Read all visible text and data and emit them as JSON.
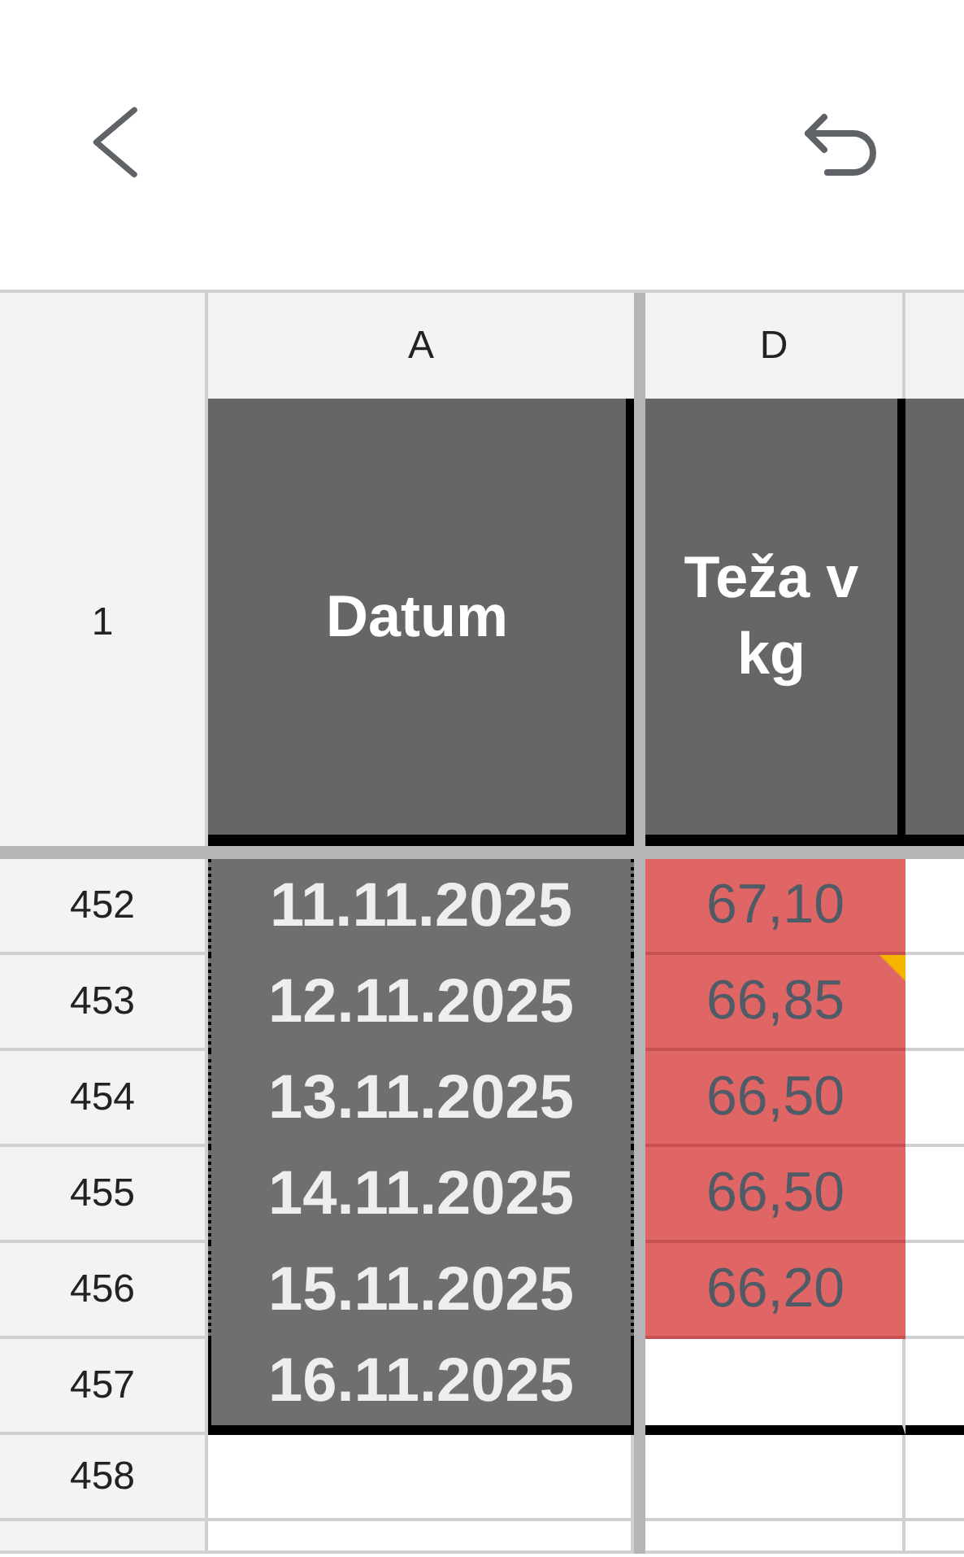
{
  "columns": [
    "A",
    "D"
  ],
  "header_row": {
    "number": "1",
    "cells": [
      "Datum",
      "Teža v kg"
    ]
  },
  "rows": [
    {
      "number": "452",
      "date": "11.11.2025",
      "weight": "67,10",
      "note": false
    },
    {
      "number": "453",
      "date": "12.11.2025",
      "weight": "66,85",
      "note": true
    },
    {
      "number": "454",
      "date": "13.11.2025",
      "weight": "66,50",
      "note": false
    },
    {
      "number": "455",
      "date": "14.11.2025",
      "weight": "66,50",
      "note": false
    },
    {
      "number": "456",
      "date": "15.11.2025",
      "weight": "66,20",
      "note": false
    },
    {
      "number": "457",
      "date": "16.11.2025"
    }
  ],
  "empty_rows": [
    {
      "number": "458"
    }
  ]
}
